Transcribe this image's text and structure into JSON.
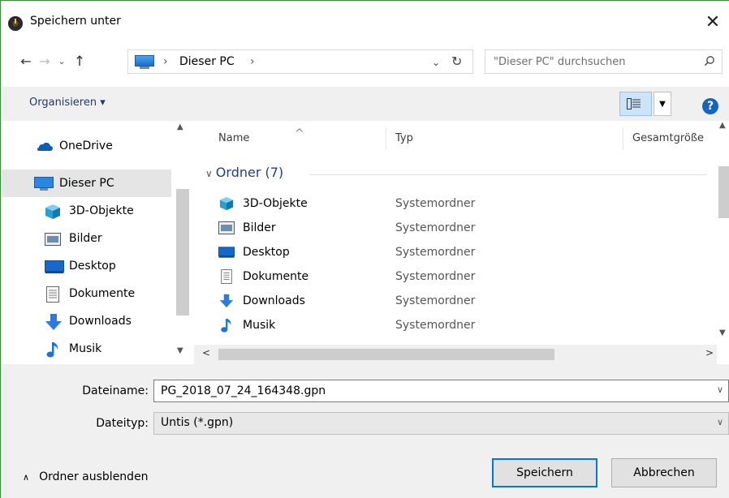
{
  "window": {
    "title": "Speichern unter",
    "close": "✕"
  },
  "address": {
    "crumb": "Dieser PC",
    "sep": "›",
    "search_placeholder": "\"Dieser PC\" durchsuchen"
  },
  "nav_buttons": {
    "back": "←",
    "forward": "→",
    "history": "⌄",
    "up": "↑",
    "dropdown": "⌄",
    "refresh": "↻"
  },
  "toolbar": {
    "organize": "Organisieren ▾",
    "help": "?"
  },
  "sidebar": {
    "items": [
      {
        "label": "OneDrive",
        "icon": "cloud-icon"
      },
      {
        "label": "Dieser PC",
        "icon": "pc-icon",
        "selected": true
      },
      {
        "label": "3D-Objekte",
        "icon": "cube-icon"
      },
      {
        "label": "Bilder",
        "icon": "pictures-icon"
      },
      {
        "label": "Desktop",
        "icon": "desktop-icon"
      },
      {
        "label": "Dokumente",
        "icon": "document-icon"
      },
      {
        "label": "Downloads",
        "icon": "download-icon"
      },
      {
        "label": "Musik",
        "icon": "music-icon"
      }
    ]
  },
  "file_list": {
    "columns": {
      "name": "Name",
      "type": "Typ",
      "size": "Gesamtgröße"
    },
    "group": "Ordner (7)",
    "rows": [
      {
        "name": "3D-Objekte",
        "type": "Systemordner",
        "icon": "cube-icon"
      },
      {
        "name": "Bilder",
        "type": "Systemordner",
        "icon": "pictures-icon"
      },
      {
        "name": "Desktop",
        "type": "Systemordner",
        "icon": "desktop-icon"
      },
      {
        "name": "Dokumente",
        "type": "Systemordner",
        "icon": "document-icon"
      },
      {
        "name": "Downloads",
        "type": "Systemordner",
        "icon": "download-icon"
      },
      {
        "name": "Musik",
        "type": "Systemordner",
        "icon": "music-icon"
      }
    ]
  },
  "form": {
    "filename_label": "Dateiname:",
    "filename_value": "PG_2018_07_24_164348.gpn",
    "filetype_label": "Dateityp:",
    "filetype_value": "Untis (*.gpn)"
  },
  "footer": {
    "hide_folders": "Ordner ausblenden",
    "save": "Speichern",
    "cancel": "Abbrechen"
  },
  "colors": {
    "accent": "#0078d7",
    "selection": "#e5e5e5",
    "group_heading": "#1e3f8a"
  }
}
